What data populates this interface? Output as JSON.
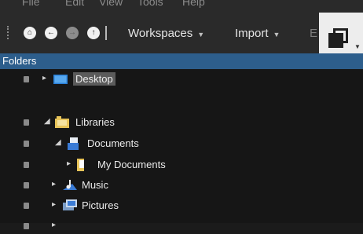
{
  "menu": [
    "File",
    "Edit",
    "View",
    "Tools",
    "Help"
  ],
  "toolbar": {
    "workspaces_label": "Workspaces",
    "import_label": "Import",
    "faded_label": "E",
    "caret": "▼"
  },
  "panel": {
    "title": "Folders"
  },
  "tree": {
    "desktop": "Desktop",
    "libraries": "Libraries",
    "documents": "Documents",
    "my_documents": "My Documents",
    "music": "Music",
    "pictures": "Pictures"
  }
}
